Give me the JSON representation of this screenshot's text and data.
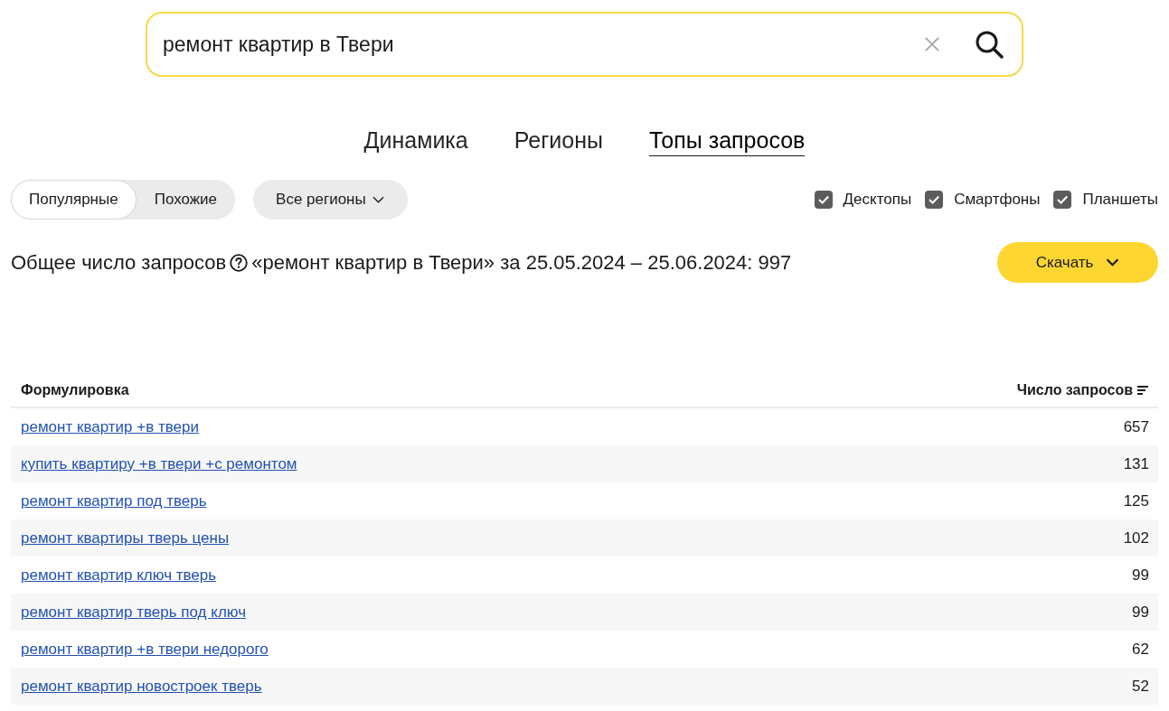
{
  "search": {
    "value": "ремонт квартир в Твери"
  },
  "tabs": [
    {
      "label": "Динамика",
      "selected": false
    },
    {
      "label": "Регионы",
      "selected": false
    },
    {
      "label": "Топы запросов",
      "selected": true
    }
  ],
  "mode_switch": [
    {
      "label": "Популярные",
      "selected": true
    },
    {
      "label": "Похожие",
      "selected": false
    }
  ],
  "region_dropdown": {
    "label": "Все регионы"
  },
  "devices": [
    {
      "label": "Десктопы",
      "checked": true
    },
    {
      "label": "Смартфоны",
      "checked": true
    },
    {
      "label": "Планшеты",
      "checked": true
    }
  ],
  "summary": {
    "label": "Общее число запросов",
    "text": "«ремонт квартир в Твери» за 25.05.2024 – 25.06.2024: 997"
  },
  "download_button": {
    "label": "Скачать"
  },
  "table": {
    "columns": [
      "Формулировка",
      "Число запросов"
    ],
    "rows": [
      {
        "phrase": "ремонт квартир +в твери",
        "count": "657"
      },
      {
        "phrase": "купить квартиру +в твери +с ремонтом",
        "count": "131"
      },
      {
        "phrase": "ремонт квартир под тверь",
        "count": "125"
      },
      {
        "phrase": "ремонт квартиры тверь цены",
        "count": "102"
      },
      {
        "phrase": "ремонт квартир ключ тверь",
        "count": "99"
      },
      {
        "phrase": "ремонт квартир тверь под ключ",
        "count": "99"
      },
      {
        "phrase": "ремонт квартир +в твери недорого",
        "count": "62"
      },
      {
        "phrase": "ремонт квартир новостроек тверь",
        "count": "52"
      }
    ]
  }
}
